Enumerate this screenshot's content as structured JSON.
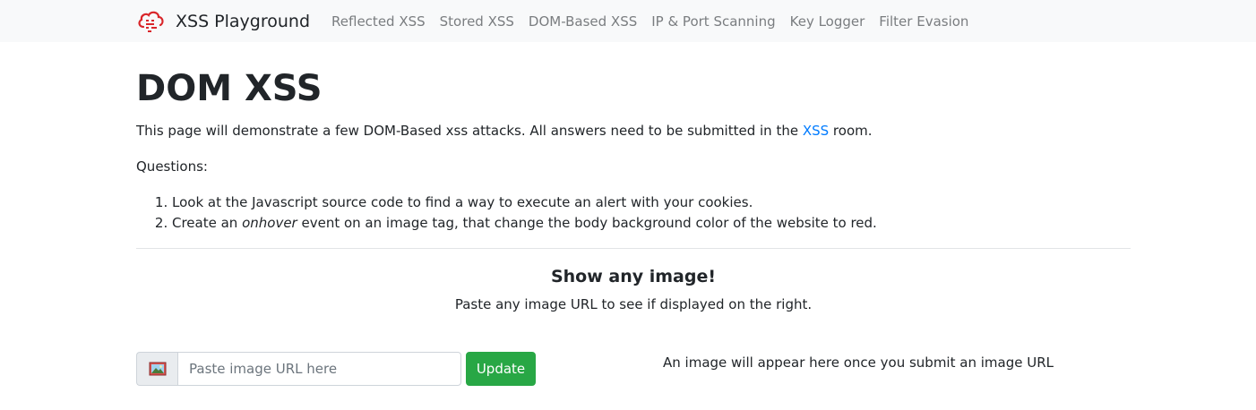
{
  "navbar": {
    "brand": "XSS Playground",
    "links": [
      "Reflected XSS",
      "Stored XSS",
      "DOM-Based XSS",
      "IP & Port Scanning",
      "Key Logger",
      "Filter Evasion"
    ]
  },
  "page": {
    "title": "DOM XSS",
    "intro_before": "This page will demonstrate a few DOM-Based xss attacks. All answers need to be submitted in the ",
    "intro_link": "XSS",
    "intro_after": " room.",
    "questions_label": "Questions:",
    "q1": "Look at the Javascript source code to find a way to execute an alert with your cookies.",
    "q2_before": "Create an ",
    "q2_em": "onhover",
    "q2_after": " event on an image tag, that change the body background color of the website to red."
  },
  "image_section": {
    "title": "Show any image!",
    "subtitle": "Paste any image URL to see if displayed on the right.",
    "input_placeholder": "Paste image URL here",
    "input_value": "",
    "button_label": "Update",
    "image_note": "An image will appear here once you submit an image URL"
  },
  "colors": {
    "link": "#007bff",
    "button": "#28a745",
    "logo": "#d9262a"
  },
  "icons": {
    "brand": "cloud-logo-icon",
    "input": "image-icon"
  }
}
